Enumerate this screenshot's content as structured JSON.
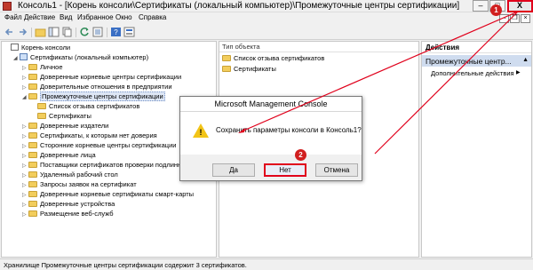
{
  "window": {
    "title": "Консоль1 - [Корень консоли\\Сертификаты (локальный компьютер)\\Промежуточные центры сертификации]",
    "minimize": "–",
    "maximize": "□",
    "close": "X"
  },
  "menu": {
    "items": [
      "Файл",
      "Действие",
      "Вид",
      "Избранное",
      "Окно",
      "Справка"
    ]
  },
  "mdi": {
    "minimize": "–",
    "restore": "❐",
    "close": "×"
  },
  "tree": {
    "items": [
      {
        "label": "Корень консоли"
      },
      {
        "label": "Сертификаты (локальный компьютер)"
      },
      {
        "label": "Личное"
      },
      {
        "label": "Доверенные корневые центры сертификации"
      },
      {
        "label": "Доверительные отношения в предприятии"
      },
      {
        "label": "Промежуточные центры сертификации"
      },
      {
        "label": "Список отзыва сертификатов"
      },
      {
        "label": "Сертификаты"
      },
      {
        "label": "Доверенные издатели"
      },
      {
        "label": "Сертификаты, к которым нет доверия"
      },
      {
        "label": "Сторонние корневые центры сертификации"
      },
      {
        "label": "Доверенные лица"
      },
      {
        "label": "Поставщики сертификатов проверки подлинности"
      },
      {
        "label": "Удаленный рабочий стол"
      },
      {
        "label": "Запросы заявок на сертификат"
      },
      {
        "label": "Доверенные корневые сертификаты смарт-карты"
      },
      {
        "label": "Доверенные устройства"
      },
      {
        "label": "Размещение веб-служб"
      }
    ]
  },
  "content": {
    "column_header": "Тип объекта",
    "rows": [
      "Список отзыва сертификатов",
      "Сертификаты"
    ]
  },
  "actions": {
    "title": "Действия",
    "section": "Промежуточные центр...",
    "item": "Дополнительные действия"
  },
  "status": "Хранилище Промежуточные центры сертификации содержит 3 сертификатов.",
  "dialog": {
    "title": "Microsoft Management Console",
    "message": "Сохранить параметры консоли в Консоль1?",
    "yes": "Да",
    "no": "Нет",
    "cancel": "Отмена"
  },
  "callouts": {
    "first": "1",
    "second": "2"
  },
  "colors": {
    "accent_red": "#e0001b",
    "selection": "#cfdcef"
  }
}
